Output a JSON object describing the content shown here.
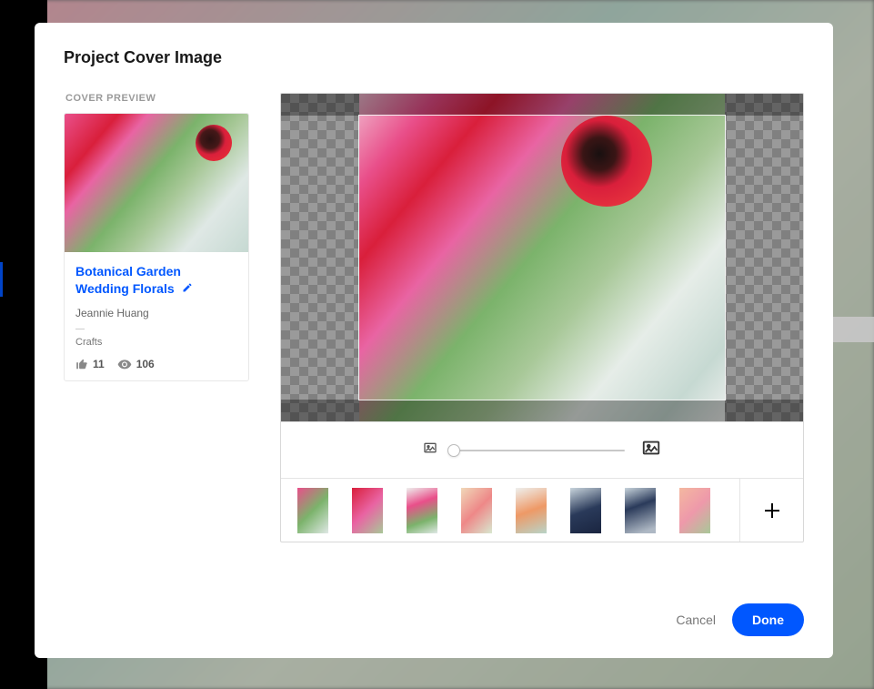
{
  "modal": {
    "title": "Project Cover Image",
    "preview_label": "COVER PREVIEW",
    "cancel": "Cancel",
    "done": "Done"
  },
  "card": {
    "title": "Botanical Garden Wedding Florals",
    "author": "Jeannie Huang",
    "category": "Crafts",
    "likes": "11",
    "views": "106"
  },
  "thumbnails": {
    "count": 8
  }
}
